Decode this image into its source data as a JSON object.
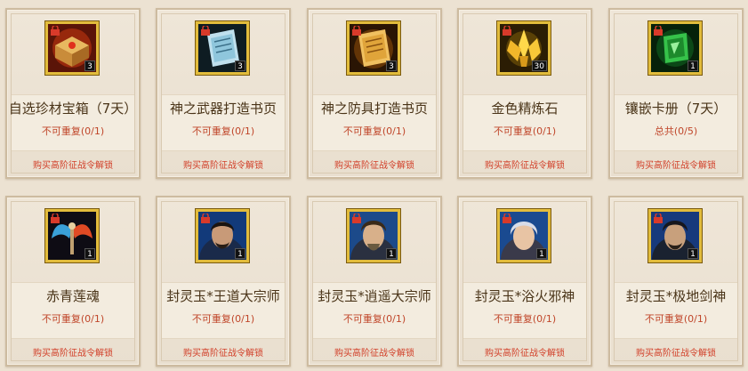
{
  "rows": [
    [
      {
        "name": "自选珍材宝箱（7天）",
        "repeat": "不可重复(0/1)",
        "unlock": "购买高阶征战令解锁",
        "qty": "3",
        "icon": "treasure-chest-icon"
      },
      {
        "name": "神之武器打造书页",
        "repeat": "不可重复(0/1)",
        "unlock": "购买高阶征战令解锁",
        "qty": "3",
        "icon": "weapon-page-icon"
      },
      {
        "name": "神之防具打造书页",
        "repeat": "不可重复(0/1)",
        "unlock": "购买高阶征战令解锁",
        "qty": "3",
        "icon": "armor-page-icon"
      },
      {
        "name": "金色精炼石",
        "repeat": "不可重复(0/1)",
        "unlock": "购买高阶征战令解锁",
        "qty": "30",
        "icon": "gold-crystal-icon"
      },
      {
        "name": "镶嵌卡册（7天）",
        "repeat": "总共(0/5)",
        "unlock": "购买高阶征战令解锁",
        "qty": "1",
        "icon": "green-card-album-icon"
      }
    ],
    [
      {
        "name": "赤青莲魂",
        "repeat": "不可重复(0/1)",
        "unlock": "购买高阶征战令解锁",
        "qty": "1",
        "icon": "winged-soul-icon"
      },
      {
        "name": "封灵玉*王道大宗师",
        "repeat": "不可重复(0/1)",
        "unlock": "购买高阶征战令解锁",
        "qty": "1",
        "icon": "portrait-icon"
      },
      {
        "name": "封灵玉*逍遥大宗师",
        "repeat": "不可重复(0/1)",
        "unlock": "购买高阶征战令解锁",
        "qty": "1",
        "icon": "portrait-icon"
      },
      {
        "name": "封灵玉*浴火邪神",
        "repeat": "不可重复(0/1)",
        "unlock": "购买高阶征战令解锁",
        "qty": "1",
        "icon": "portrait-icon"
      },
      {
        "name": "封灵玉*极地剑神",
        "repeat": "不可重复(0/1)",
        "unlock": "购买高阶征战令解锁",
        "qty": "1",
        "icon": "portrait-icon"
      }
    ]
  ]
}
